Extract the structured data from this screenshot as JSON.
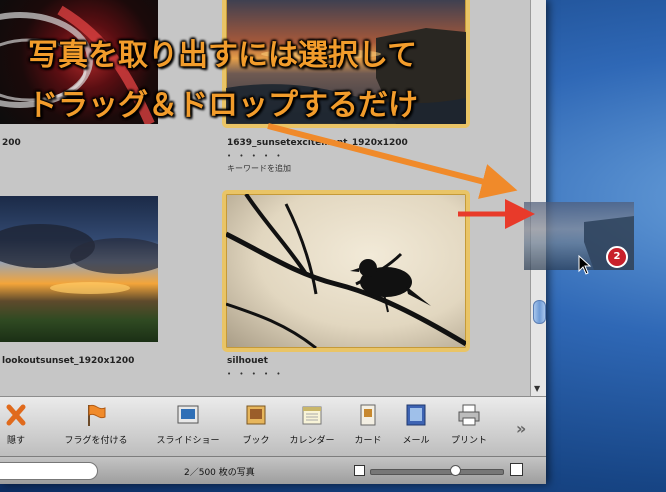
{
  "photos": [
    {
      "name": "",
      "caption": "200"
    },
    {
      "name": "1639_sunsetexcitement_1920x1200",
      "caption": "1639_sunsetexcitement_1920x1200",
      "rating": "• • • • •",
      "keyword_prompt": "キーワードを追加"
    },
    {
      "name": "lookoutsunset_1920x1200",
      "caption": "lookoutsunset_1920x1200"
    },
    {
      "name": "silhouet",
      "caption": "silhouet",
      "rating": "• • • • •"
    }
  ],
  "toolbar": {
    "items": [
      {
        "label": "隠す",
        "icon": "x-icon"
      },
      {
        "label": "フラグを付ける",
        "icon": "flag-icon"
      },
      {
        "label": "スライドショー",
        "icon": "slideshow-icon"
      },
      {
        "label": "ブック",
        "icon": "book-icon"
      },
      {
        "label": "カレンダー",
        "icon": "calendar-icon"
      },
      {
        "label": "カード",
        "icon": "card-icon"
      },
      {
        "label": "メール",
        "icon": "mail-icon"
      },
      {
        "label": "プリント",
        "icon": "print-icon"
      }
    ],
    "more": "»"
  },
  "bottombar": {
    "photo_count": "2／500 枚の写真"
  },
  "annotation": {
    "line1": "写真を取り出すには選択して",
    "line2": "ドラッグ＆ドロップするだけ"
  },
  "drag": {
    "badge_count": "2"
  },
  "colors": {
    "selection": "#e9c466",
    "annotation_text": "#f29c2b",
    "arrow": "#f08a2a",
    "badge": "#c8202b"
  }
}
